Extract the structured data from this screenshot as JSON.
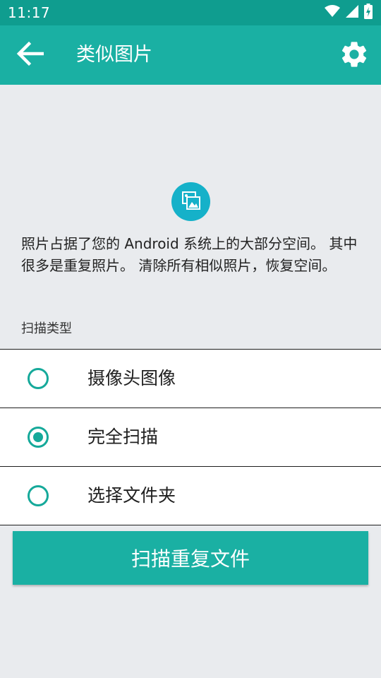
{
  "status_bar": {
    "time": "11:17",
    "icons": [
      "wifi-icon",
      "signal-icon",
      "battery-charging-icon"
    ]
  },
  "app_bar": {
    "title": "类似图片",
    "back_icon": "arrow-left-icon",
    "settings_icon": "gear-icon"
  },
  "hero": {
    "icon": "photo-gallery-icon"
  },
  "description": "照片占据了您的 Android 系统上的大部分空间。 其中很多是重复照片。 清除所有相似照片，恢复空间。",
  "scan_type_label": "扫描类型",
  "options": [
    {
      "label": "摄像头图像",
      "selected": false
    },
    {
      "label": "完全扫描",
      "selected": true
    },
    {
      "label": "选择文件夹",
      "selected": false
    }
  ],
  "scan_button_label": "扫描重复文件",
  "colors": {
    "status_bar": "#0f9d8f",
    "app_bar": "#1ab0a3",
    "accent": "#15a99a",
    "hero_circle": "#15b1c9",
    "background": "#e9ebee"
  }
}
